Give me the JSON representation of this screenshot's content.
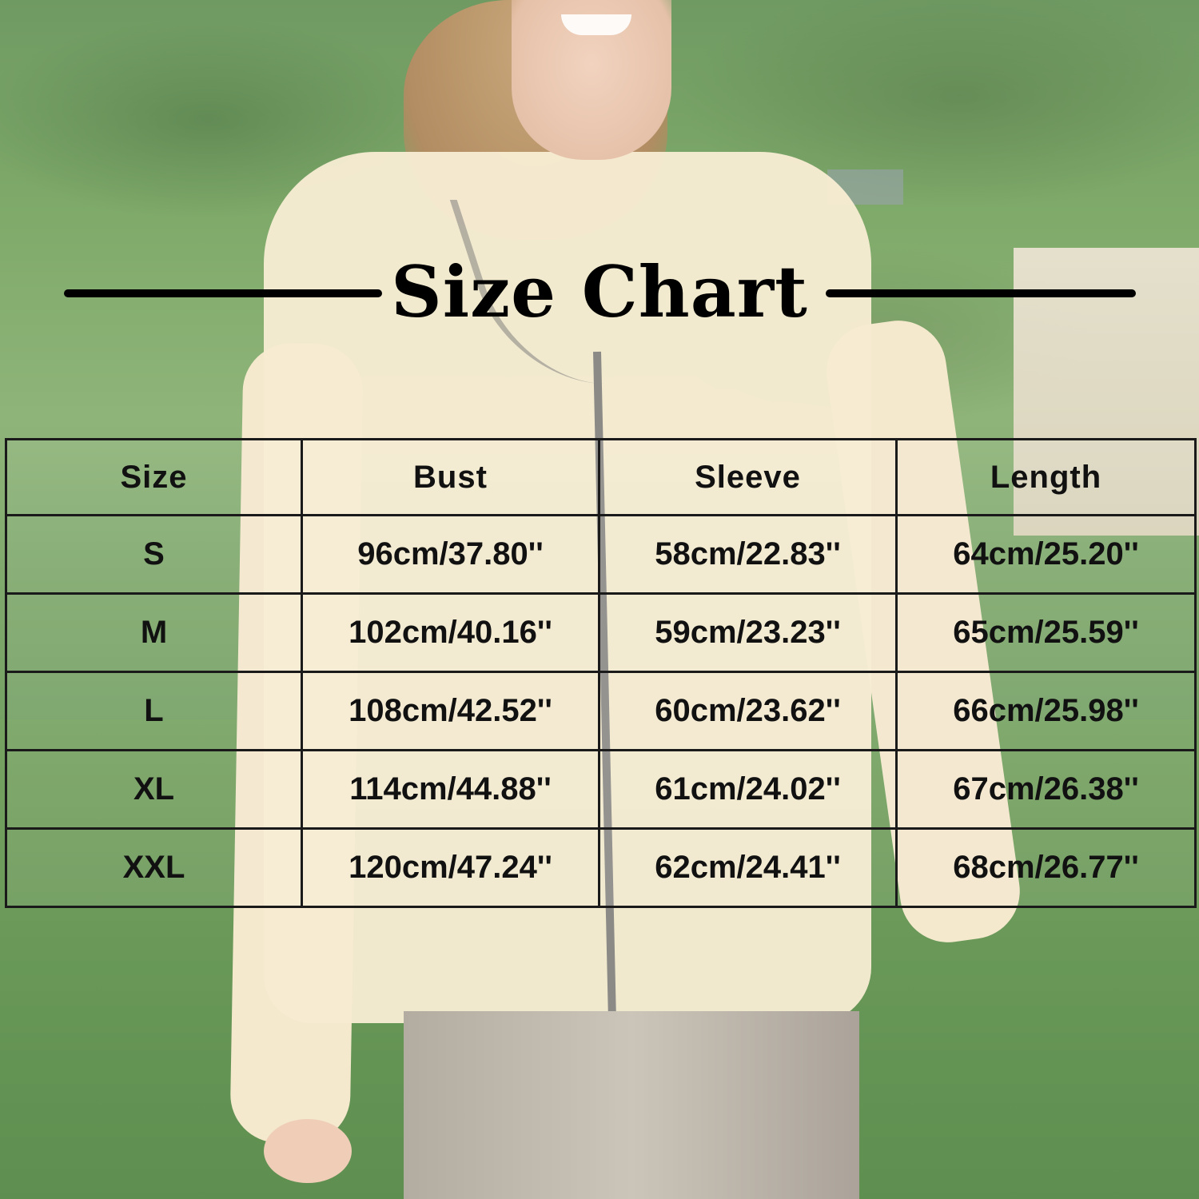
{
  "title": "Size Chart",
  "table": {
    "headers": [
      "Size",
      "Bust",
      "Sleeve",
      "Length"
    ],
    "rows": [
      {
        "size": "S",
        "bust": "96cm/37.80''",
        "sleeve": "58cm/22.83''",
        "length": "64cm/25.20''"
      },
      {
        "size": "M",
        "bust": "102cm/40.16''",
        "sleeve": "59cm/23.23''",
        "length": "65cm/25.59''"
      },
      {
        "size": "L",
        "bust": "108cm/42.52''",
        "sleeve": "60cm/23.62''",
        "length": "66cm/25.98''"
      },
      {
        "size": "XL",
        "bust": "114cm/44.88''",
        "sleeve": "61cm/24.02''",
        "length": "67cm/26.38''"
      },
      {
        "size": "XXL",
        "bust": "120cm/47.24''",
        "sleeve": "62cm/24.41''",
        "length": "68cm/26.77''"
      }
    ]
  },
  "colors": {
    "jacket": "#f7ecd2",
    "text": "#111111",
    "grid_lines": "#1a1a1a",
    "background_grass": "#7faa6a"
  }
}
